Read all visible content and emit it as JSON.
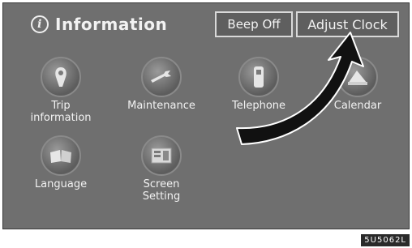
{
  "header": {
    "title": "Information",
    "icon": "info-icon"
  },
  "buttons": {
    "beep_off": "Beep Off",
    "adjust_clock": "Adjust Clock"
  },
  "menu": [
    {
      "label": "Trip\ninformation",
      "icon": "trip-icon"
    },
    {
      "label": "Maintenance",
      "icon": "wrench-icon"
    },
    {
      "label": "Telephone",
      "icon": "telephone-icon"
    },
    {
      "label": "Calendar",
      "icon": "calendar-icon"
    },
    {
      "label": "Language",
      "icon": "book-icon"
    },
    {
      "label": "Screen\nSetting",
      "icon": "screen-icon"
    }
  ],
  "watermark": "5U5062L",
  "colors": {
    "screen_bg": "#6f6f6f",
    "text": "#f2f2f2",
    "arrow": "#111111"
  }
}
